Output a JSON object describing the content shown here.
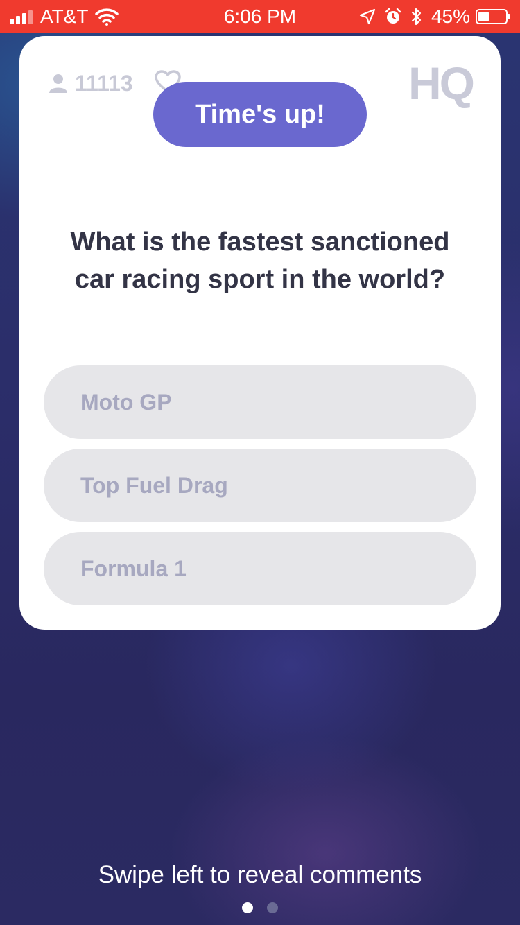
{
  "status_bar": {
    "carrier": "AT&T",
    "time": "6:06 PM",
    "battery": "45%",
    "battery_level": 0.45
  },
  "card": {
    "viewer_count": "11113",
    "logo": "HQ",
    "timer_banner": "Time's up!",
    "question": "What is the fastest sanctioned car racing sport in the world?",
    "answers": [
      {
        "label": "Moto GP"
      },
      {
        "label": "Top Fuel Drag"
      },
      {
        "label": "Formula 1"
      }
    ]
  },
  "footer": {
    "swipe_hint": "Swipe left to reveal comments",
    "pages": 2,
    "active_page": 1
  },
  "colors": {
    "status_bar": "#f03a2e",
    "banner": "#6a68cf",
    "answer_bg": "#e6e6e9",
    "answer_text": "#a7a8c0"
  },
  "icons": [
    "signal-icon",
    "wifi-icon",
    "location-icon",
    "alarm-icon",
    "bluetooth-icon",
    "battery-icon",
    "person-icon",
    "heart-icon"
  ]
}
